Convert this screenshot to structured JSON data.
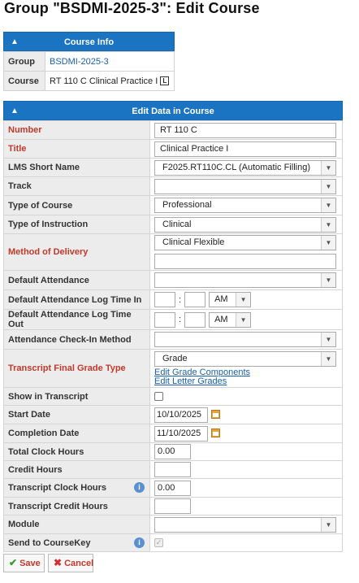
{
  "page": {
    "title": "Group \"BSDMI-2025-3\": Edit Course"
  },
  "course_info": {
    "header": "Course Info",
    "rows": [
      {
        "label": "Group",
        "value": "BSDMI-2025-3"
      },
      {
        "label": "Course",
        "value": "RT 110 C Clinical Practice I",
        "badge": "L"
      }
    ]
  },
  "edit": {
    "header": "Edit Data in Course",
    "number_label": "Number",
    "number_value": "RT 110 C",
    "title_label": "Title",
    "title_value": "Clinical Practice I",
    "lms_label": "LMS Short Name",
    "lms_value": "F2025.RT110C.CL (Automatic Filling)",
    "track_label": "Track",
    "track_value": "",
    "type_course_label": "Type of Course",
    "type_course_value": "Professional",
    "type_instr_label": "Type of Instruction",
    "type_instr_value": "Clinical",
    "method_label": "Method of Delivery",
    "method_value": "Clinical Flexible",
    "method_extra": "",
    "def_att_label": "Default Attendance",
    "def_att_value": "",
    "log_in_label": "Default Attendance Log Time In",
    "log_in_ampm": "AM",
    "log_out_label": "Default Attendance Log Time Out",
    "log_out_ampm": "AM",
    "time_sep": ":",
    "checkin_label": "Attendance Check-In Method",
    "checkin_value": "",
    "grade_type_label": "Transcript Final Grade Type",
    "grade_type_value": "Grade",
    "grade_components_link": "Edit Grade Components",
    "letter_grades_link": "Edit Letter Grades",
    "show_transcript_label": "Show in Transcript",
    "start_label": "Start Date",
    "start_value": "10/10/2025",
    "completion_label": "Completion Date",
    "completion_value": "11/10/2025",
    "total_clock_label": "Total Clock Hours",
    "total_clock_value": "0.00",
    "credit_label": "Credit Hours",
    "credit_value": "",
    "tr_clock_label": "Transcript Clock Hours",
    "tr_clock_value": "0.00",
    "tr_credit_label": "Transcript Credit Hours",
    "tr_credit_value": "",
    "module_label": "Module",
    "module_value": "",
    "coursekey_label": "Send to CourseKey",
    "checkmark": "✓"
  },
  "buttons": {
    "save": "Save",
    "cancel": "Cancel"
  },
  "colors": {
    "header": "#1a74c1",
    "required": "#c0392b",
    "label_bg": "#ececec"
  },
  "icons": [
    "chevron-up-icon",
    "info-icon",
    "calendar-icon",
    "checkmark-icon",
    "cross-icon",
    "dropdown-arrow-icon"
  ]
}
